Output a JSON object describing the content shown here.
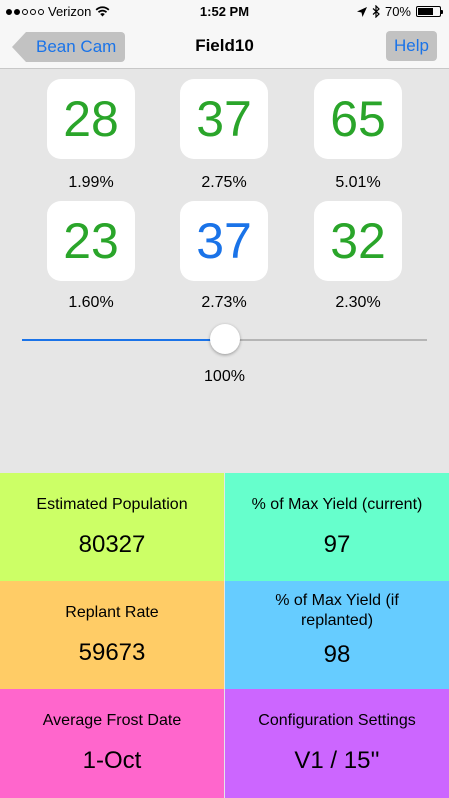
{
  "status_bar": {
    "carrier": "Verizon",
    "time": "1:52 PM",
    "battery": "70%",
    "battery_level": 0.7
  },
  "nav": {
    "back_label": "Bean Cam",
    "title": "Field10",
    "help_label": "Help"
  },
  "tiles": [
    {
      "count": "28",
      "percent": "1.99%",
      "color": "#2aa52a"
    },
    {
      "count": "37",
      "percent": "2.75%",
      "color": "#2aa52a"
    },
    {
      "count": "65",
      "percent": "5.01%",
      "color": "#2aa52a"
    },
    {
      "count": "23",
      "percent": "1.60%",
      "color": "#2aa52a"
    },
    {
      "count": "37",
      "percent": "2.73%",
      "color": "#1a73e8"
    },
    {
      "count": "32",
      "percent": "2.30%",
      "color": "#2aa52a"
    }
  ],
  "slider": {
    "value_label": "100%",
    "fraction": 0.5
  },
  "stats": [
    {
      "label": "Estimated Population",
      "value": "80327",
      "color": "#ccff66"
    },
    {
      "label": "% of Max Yield (current)",
      "value": "97",
      "color": "#66ffcc"
    },
    {
      "label": "Replant Rate",
      "value": "59673",
      "color": "#ffcc66"
    },
    {
      "label": "% of Max Yield (if replanted)",
      "value": "98",
      "color": "#66ccff"
    },
    {
      "label": "Average Frost Date",
      "value": "1-Oct",
      "color": "#ff66cc"
    },
    {
      "label": "Configuration Settings",
      "value": "V1 / 15''",
      "color": "#cc66ff"
    }
  ]
}
